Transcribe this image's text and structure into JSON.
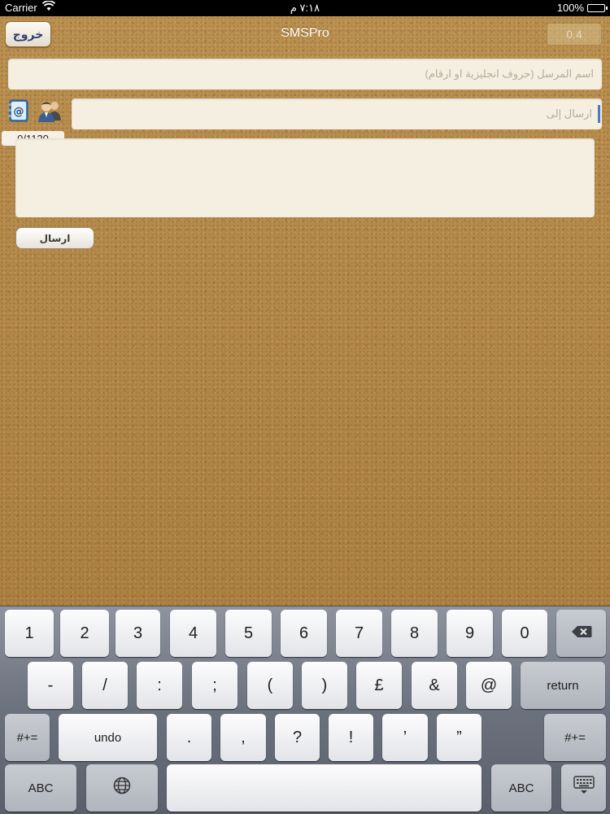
{
  "status_bar": {
    "carrier": "Carrier",
    "time": "٧:١٨ م",
    "battery": "100%"
  },
  "nav": {
    "title": "SMSPro",
    "exit_label": "خروج",
    "counter": "0.4"
  },
  "form": {
    "sender_placeholder": "اسم المرسل (حروف انجليزية او ارقام)",
    "recipient_placeholder": "ارسال إلى",
    "char_count": "0/1120",
    "message_value": "",
    "send_label": "ارسال"
  },
  "icons": {
    "address_book": "address-book-icon",
    "contacts": "contacts-icon",
    "wifi": "wifi-icon",
    "battery": "battery-icon",
    "globe": "globe-icon",
    "backspace": "backspace-icon",
    "dismiss_keyboard": "keyboard-dismiss-icon"
  },
  "keyboard": {
    "row1": [
      "1",
      "2",
      "3",
      "4",
      "5",
      "6",
      "7",
      "8",
      "9",
      "0"
    ],
    "row2": [
      "-",
      "/",
      ":",
      ";",
      "(",
      ")",
      "£",
      "&",
      "@"
    ],
    "return": "return",
    "shift_symbols": "#+=",
    "undo": "undo",
    "row3": [
      ".",
      ",",
      "?",
      "!",
      "’",
      "”"
    ],
    "abc": "ABC"
  },
  "colors": {
    "exit_text": "#2f3d72",
    "caret": "#4a78c8"
  }
}
